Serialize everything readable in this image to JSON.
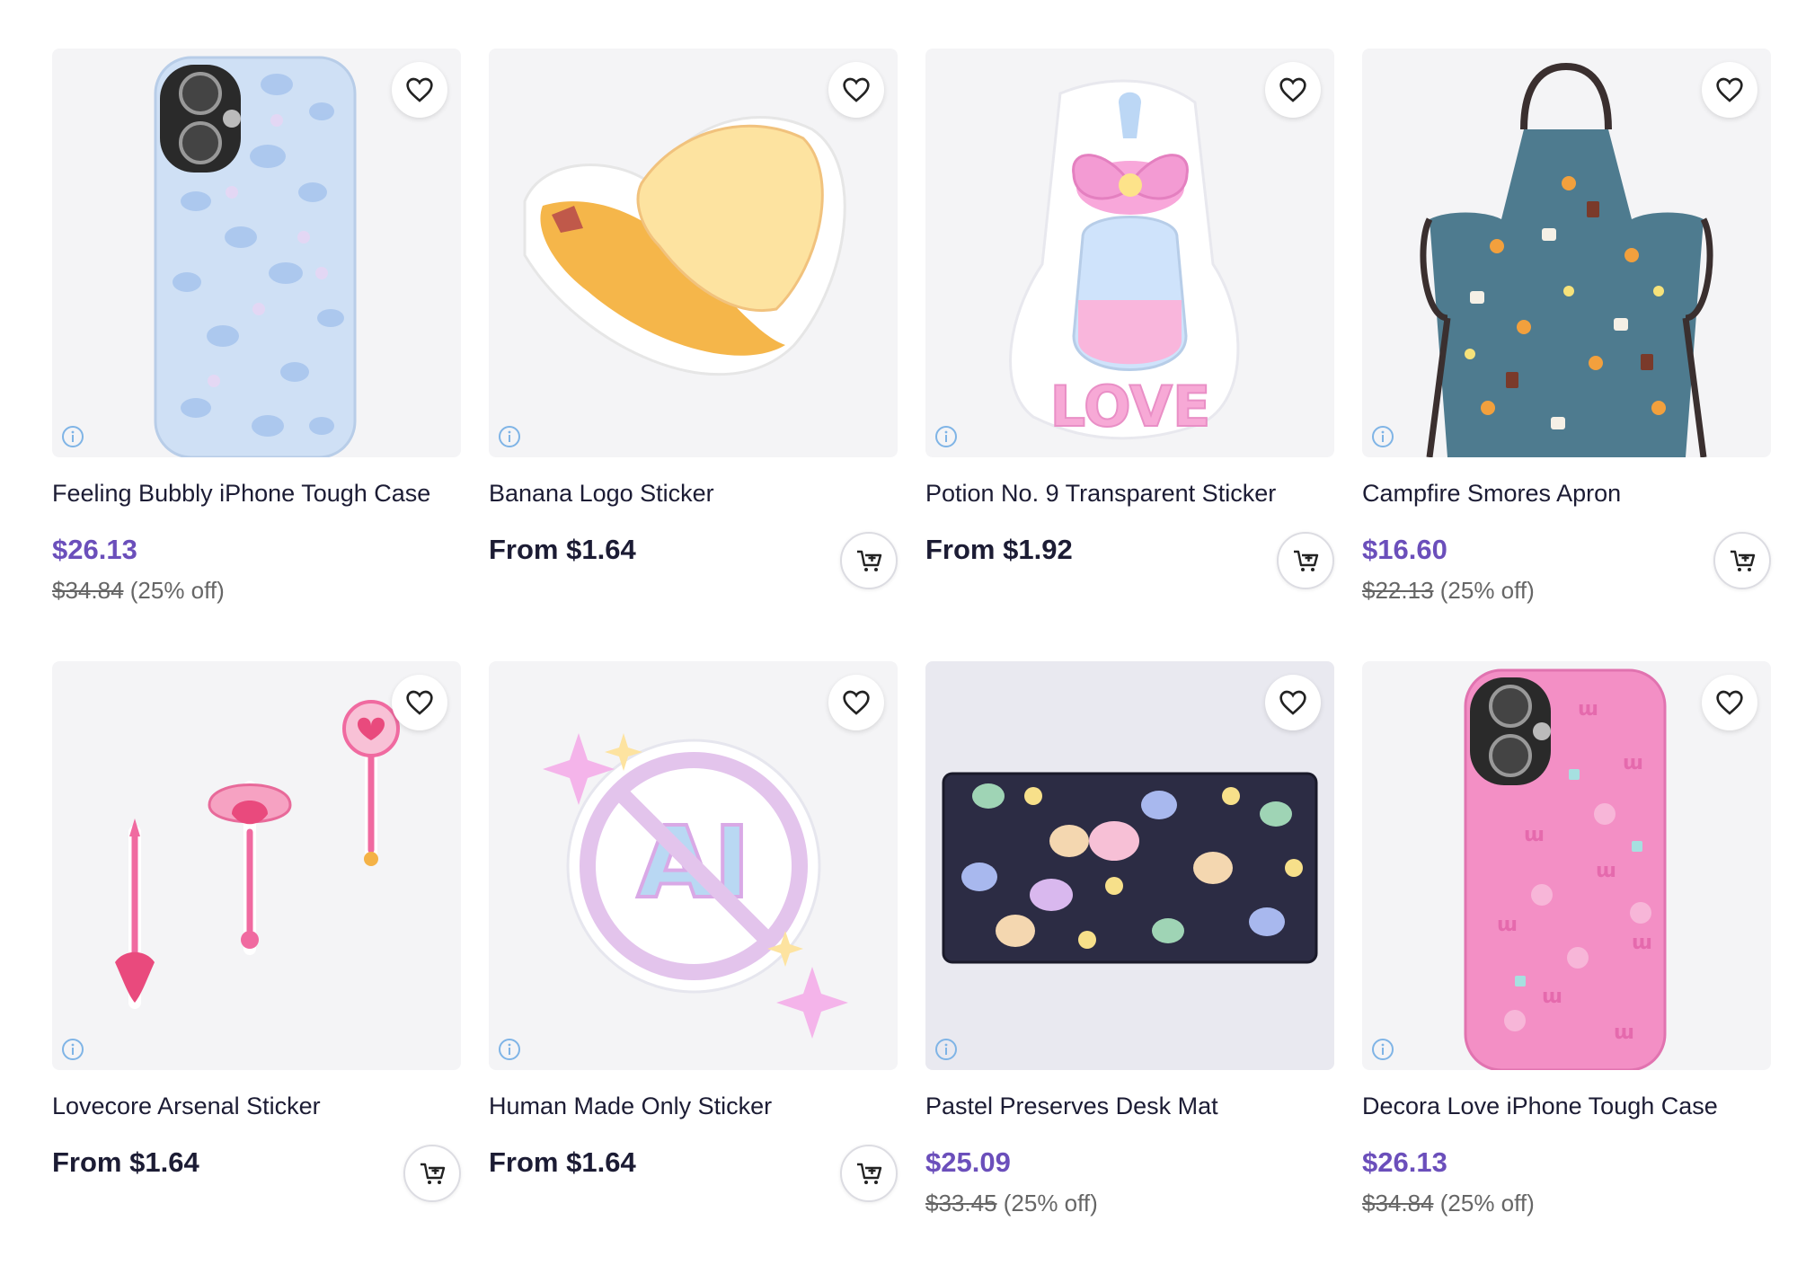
{
  "products": [
    {
      "title": "Feeling Bubbly iPhone Tough Case",
      "price": "$26.13",
      "original_price": "$34.84",
      "discount": "(25% off)"
    },
    {
      "title": "Banana Logo Sticker",
      "price": "From $1.64"
    },
    {
      "title": "Potion No. 9 Transparent Sticker",
      "price": "From $1.92"
    },
    {
      "title": "Campfire Smores Apron",
      "price": "$16.60",
      "original_price": "$22.13",
      "discount": "(25% off)"
    },
    {
      "title": "Lovecore Arsenal Sticker",
      "price": "From $1.64"
    },
    {
      "title": "Human Made Only Sticker",
      "price": "From $1.64"
    },
    {
      "title": "Pastel Preserves Desk Mat",
      "price": "$25.09",
      "original_price": "$33.45",
      "discount": "(25% off)"
    },
    {
      "title": "Decora Love iPhone Tough Case",
      "price": "$26.13",
      "original_price": "$34.84",
      "discount": "(25% off)"
    }
  ],
  "colors": {
    "sale_price": "#6b4fbb",
    "regular_price": "#1c1c34",
    "info_icon": "#7fb4e6"
  },
  "icons": {
    "favorite": "heart-icon",
    "cart": "add-to-cart-icon",
    "info": "info-icon"
  }
}
